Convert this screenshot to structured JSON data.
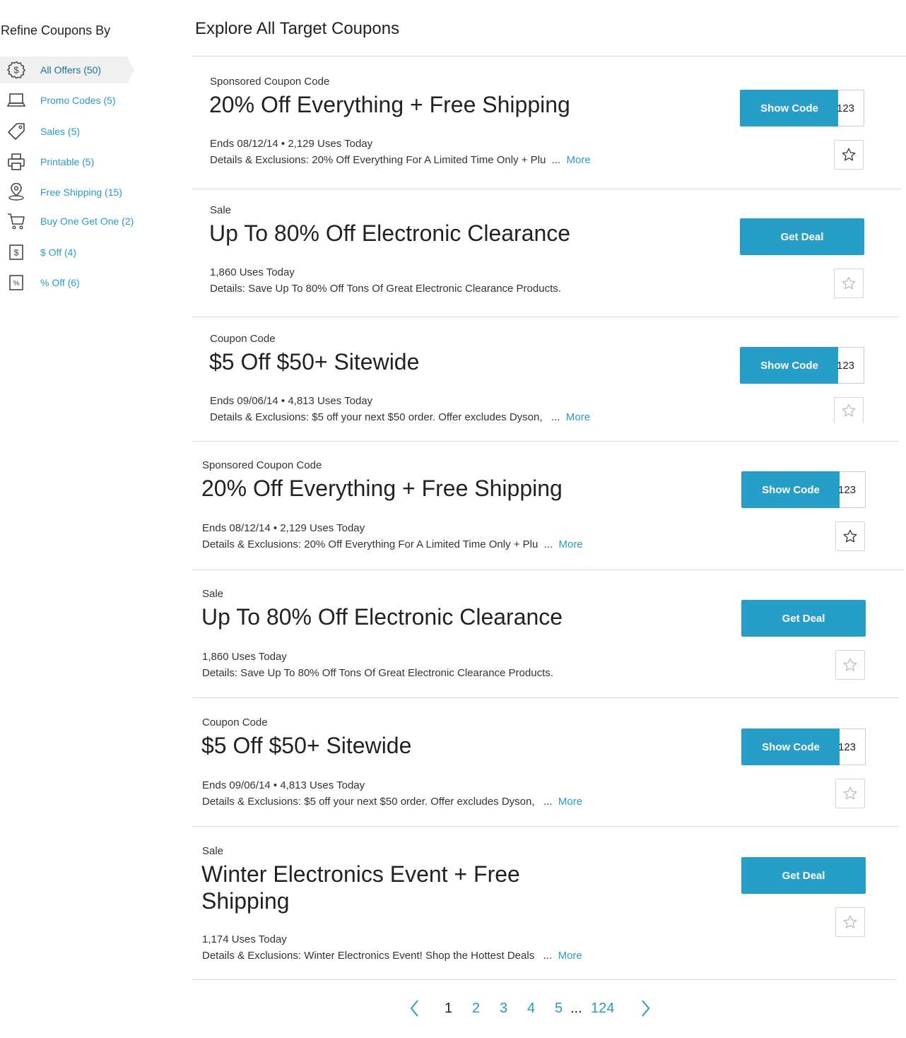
{
  "sidebar": {
    "title": "Refine Coupons By",
    "filters": [
      {
        "label": "All Offers (50)",
        "icon": "dollar-badge-icon"
      },
      {
        "label": "Promo Codes (5)",
        "icon": "laptop-icon"
      },
      {
        "label": "Sales (5)",
        "icon": "tag-icon"
      },
      {
        "label": "Printable (5)",
        "icon": "printer-icon"
      },
      {
        "label": "Free Shipping (15)",
        "icon": "location-pin-icon"
      },
      {
        "label": "Buy One Get One (2)",
        "icon": "cart-icon"
      },
      {
        "label": "$ Off (4)",
        "icon": "dollar-box-icon"
      },
      {
        "label": "% Off (6)",
        "icon": "percent-box-icon"
      }
    ]
  },
  "main": {
    "title": "Explore All Target Coupons"
  },
  "coupons": [
    {
      "type": "Sponsored Coupon Code",
      "title": "20% Off Everything + Free Shipping",
      "meta": "Ends 08/12/14  •  2,129 Uses Today",
      "details": "Details & Exclusions: 20% Off Everything For A Limited Time Only + Plu",
      "ellipsis": "...",
      "more": "More",
      "button": "Show Code",
      "peek": "123"
    },
    {
      "type": "Sale",
      "title": "Up To 80% Off Electronic Clearance",
      "meta": "1,860 Uses Today",
      "details": "Details: Save Up To 80% Off Tons Of Great Electronic Clearance Products.",
      "button": "Get Deal"
    },
    {
      "type": "Coupon Code",
      "title": "$5 Off $50+ Sitewide",
      "meta": "Ends 09/06/14  •  4,813 Uses Today",
      "details": "Details & Exclusions: $5 off your next $50 order. Offer excludes Dyson,",
      "ellipsis": "...",
      "more": "More",
      "button": "Show Code",
      "peek": "123"
    },
    {
      "type": "Sponsored Coupon Code",
      "title": "20% Off Everything + Free Shipping",
      "meta": "Ends 08/12/14  •  2,129 Uses Today",
      "details": "Details & Exclusions: 20% Off Everything For A Limited Time Only + Plu",
      "ellipsis": "...",
      "more": "More",
      "button": "Show Code",
      "peek": "123"
    },
    {
      "type": "Sale",
      "title": "Up To 80% Off Electronic Clearance",
      "meta": "1,860 Uses Today",
      "details": "Details: Save Up To 80% Off Tons Of Great Electronic Clearance Products.",
      "button": "Get Deal"
    },
    {
      "type": "Coupon Code",
      "title": "$5 Off $50+ Sitewide",
      "meta": "Ends 09/06/14  •  4,813 Uses Today",
      "details": "Details & Exclusions: $5 off your next $50 order. Offer excludes Dyson,",
      "ellipsis": "...",
      "more": "More",
      "button": "Show Code",
      "peek": "123"
    },
    {
      "type": "Sale",
      "title": "Winter Electronics Event + Free Shipping",
      "meta": "1,174 Uses Today",
      "details": "Details & Exclusions: Winter Electronics Event! Shop the Hottest Deals",
      "ellipsis": "...",
      "more": "More",
      "button": "Get Deal"
    }
  ],
  "pagination": {
    "pages": [
      "1",
      "2",
      "3",
      "4",
      "5"
    ],
    "ellipsis": "...",
    "last": "124",
    "current": "1"
  },
  "colors": {
    "accent": "#279ec8",
    "link": "#2a9bc6"
  }
}
